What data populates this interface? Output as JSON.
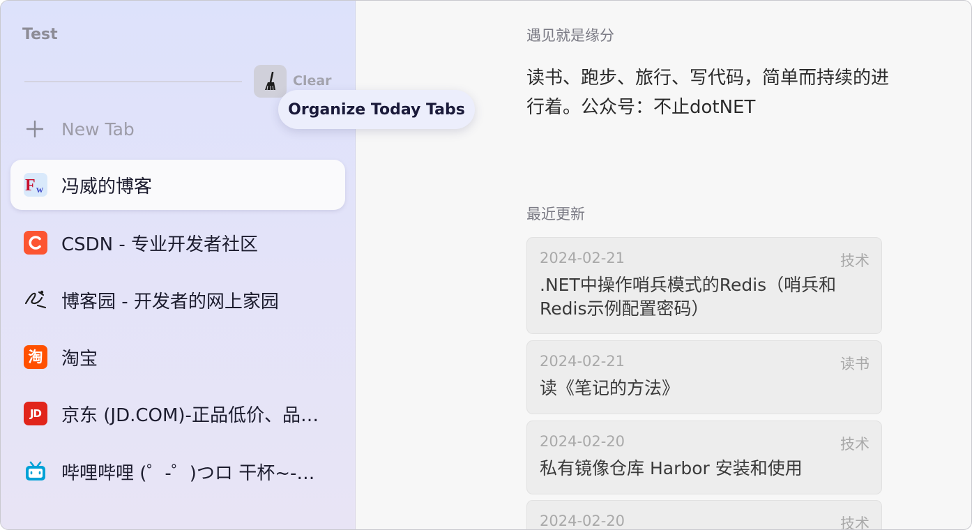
{
  "sidebar": {
    "space_title": "Test",
    "clear_label": "Clear",
    "tooltip": "Organize Today Tabs",
    "new_tab_label": "New Tab",
    "tabs": [
      {
        "title": "冯威的博客",
        "icon": "fengwei-favicon",
        "active": true
      },
      {
        "title": "CSDN - 专业开发者社区",
        "icon": "csdn-favicon",
        "color": "#fc5531"
      },
      {
        "title": "博客园 - 开发者的网上家园",
        "icon": "cnblogs-favicon"
      },
      {
        "title": "淘宝",
        "icon": "taobao-favicon",
        "color": "#ff5000"
      },
      {
        "title": "京东 (JD.COM)-正品低价、品质保障、配送及时、轻松购物！",
        "icon": "jd-favicon",
        "color": "#e1251b"
      },
      {
        "title": "哔哩哔哩 (゜-゜)つロ 干杯~-bilibili",
        "icon": "bilibili-favicon",
        "color": "#00a1d6"
      }
    ]
  },
  "main": {
    "motto_title": "遇见就是缘分",
    "motto_text": "读书、跑步、旅行、写代码，简单而持续的进行着。公众号：不止dotNET",
    "recent_title": "最近更新",
    "posts": [
      {
        "date": "2024-02-21",
        "tag": "技术",
        "title": ".NET中操作哨兵模式的Redis（哨兵和Redis示例配置密码）"
      },
      {
        "date": "2024-02-21",
        "tag": "读书",
        "title": "读《笔记的方法》"
      },
      {
        "date": "2024-02-20",
        "tag": "技术",
        "title": "私有镜像仓库 Harbor 安装和使用"
      },
      {
        "date": "2024-02-20",
        "tag": "技术",
        "title": ""
      }
    ]
  }
}
